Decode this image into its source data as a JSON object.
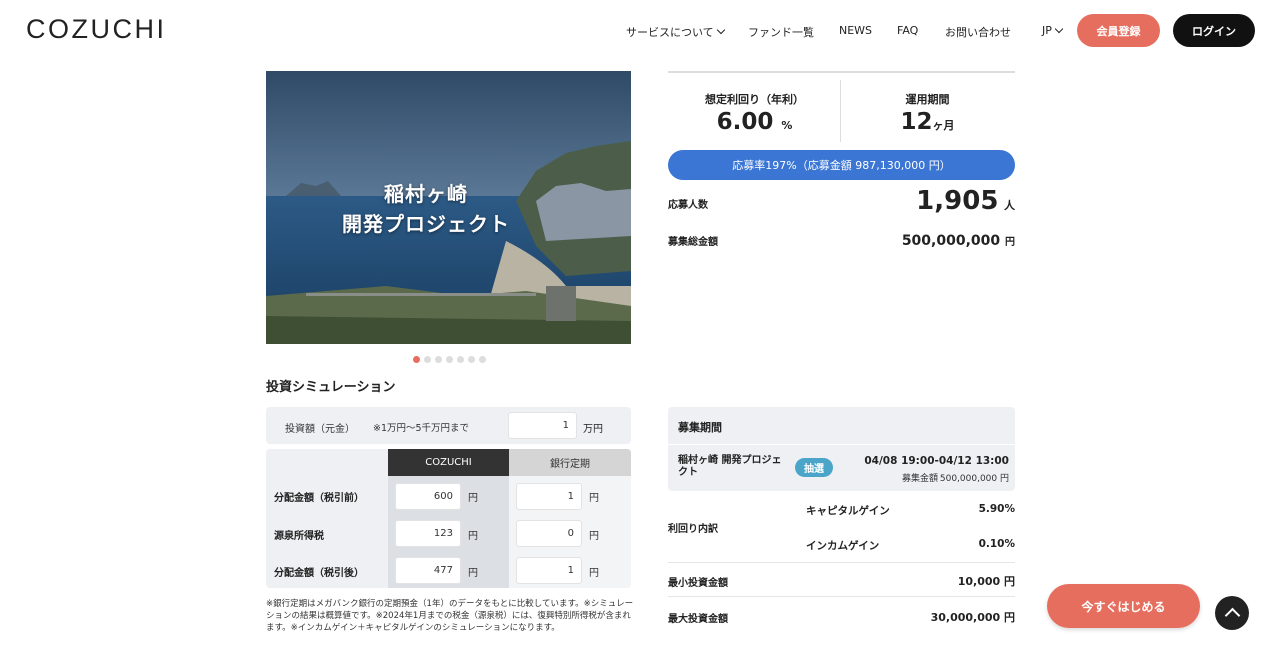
{
  "header": {
    "logo": "COZUCHI",
    "nav": {
      "service": "サービスについて",
      "funds": "ファンド一覧",
      "news": "NEWS",
      "faq": "FAQ",
      "contact": "お問い合わせ",
      "lang": "JP"
    },
    "register": "会員登録",
    "login": "ログイン"
  },
  "hero": {
    "title_line1": "稲村ヶ崎",
    "title_line2": "開発プロジェクト",
    "slide_count": 7,
    "active_slide": 1
  },
  "stats": {
    "yield_label": "想定利回り（年利）",
    "yield_value": "6.00",
    "yield_unit": "%",
    "period_label": "運用期間",
    "period_value": "12",
    "period_unit": "ヶ月",
    "application_rate": "応募率197%（応募金額 987,130,000 円）",
    "applicants_label": "応募人数",
    "applicants_value": "1,905",
    "applicants_unit": "人",
    "total_label": "募集総金額",
    "total_value": "500,000,000",
    "total_unit": "円"
  },
  "simulation": {
    "title": "投資シミュレーション",
    "amount_label": "投資額（元金）",
    "amount_range": "※1万円〜5千万円まで",
    "amount_value": "1",
    "amount_unit": "万円",
    "col_cozuchi": "COZUCHI",
    "col_bank": "銀行定期",
    "yen": "円",
    "rows": [
      {
        "label": "分配金額（税引前）",
        "cozuchi": "600",
        "bank": "1"
      },
      {
        "label": "源泉所得税",
        "cozuchi": "123",
        "bank": "0"
      },
      {
        "label": "分配金額（税引後）",
        "cozuchi": "477",
        "bank": "1"
      }
    ],
    "note": "※銀行定期はメガバンク銀行の定期預金（1年）のデータをもとに比較しています。※シミュレーションの結果は概算値です。※2024年1月までの税金（源泉税）には、復興特別所得税が含まれます。※インカムゲイン＋キャピタルゲインのシミュレーションになります。"
  },
  "recruitment": {
    "header": "募集期間",
    "project": "稲村ヶ崎 開発プロジェクト",
    "badge": "抽選",
    "dates": "04/08 19:00-04/12 13:00",
    "amount_label": "募集金額",
    "amount": "500,000,000 円"
  },
  "yield_breakdown": {
    "label": "利回り内訳",
    "capital_label": "キャピタルゲイン",
    "capital_value": "5.90%",
    "income_label": "インカムゲイン",
    "income_value": "0.10%"
  },
  "investment": {
    "min_label": "最小投資金額",
    "min_value": "10,000 円",
    "max_label": "最大投資金額",
    "max_value": "30,000,000 円"
  },
  "cta": {
    "start": "今すぐはじめる"
  },
  "colors": {
    "accent": "#e66e5e",
    "progress": "#3c76d4",
    "badge": "#4aa5c9"
  }
}
